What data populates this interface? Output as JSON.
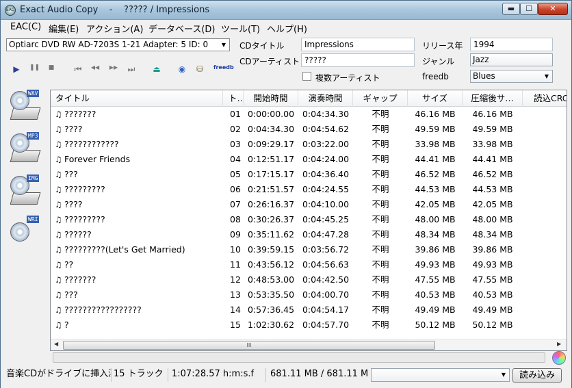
{
  "window": {
    "title": "Exact Audio Copy    -    ????? / Impressions",
    "icon_label": "EAC",
    "min_label": "▬",
    "max_label": "☐",
    "close_label": "✕"
  },
  "menu": [
    "EAC(C)",
    "編集(E)",
    "アクション(A)",
    "データベース(D)",
    "ツール(T)",
    "ヘルプ(H)"
  ],
  "drive": {
    "selected": "Optiarc DVD RW AD-7203S 1-21   Adapter: 5  ID: 0"
  },
  "cd_info": {
    "title_label": "CDタイトル",
    "title_value": "Impressions",
    "artist_label": "CDアーティスト",
    "artist_value": "?????",
    "multi_artist_label": "複数アーティスト",
    "year_label": "リリース年",
    "year_value": "1994",
    "genre_label": "ジャンル",
    "genre_value": "Jazz",
    "freedb_label": "freedb",
    "freedb_value": "Blues"
  },
  "toolbar": {
    "play": "▶",
    "pause": "❚❚",
    "stop": "■",
    "first": "⏮",
    "rewind": "◀◀",
    "forward": "▶▶",
    "last": "⏭",
    "eject": "⏏",
    "freedb_label": "freedb"
  },
  "sidebar": [
    {
      "tag": "WAV",
      "icon": "cd-to-wav-icon"
    },
    {
      "tag": "MP3",
      "icon": "cd-to-mp3-icon"
    },
    {
      "tag": "IMG",
      "icon": "cd-image-icon"
    },
    {
      "tag": "WRI",
      "icon": "write-cd-icon"
    }
  ],
  "columns": [
    "タイトル",
    "ト…",
    "開始時間",
    "演奏時間",
    "ギャップ",
    "サイズ",
    "圧縮後サ…",
    "読込CRC"
  ],
  "tracks": [
    {
      "title": "???????",
      "no": "01",
      "start": "0:00:00.00",
      "length": "0:04:34.30",
      "gap": "不明",
      "size": "46.16 MB",
      "comp": "46.16 MB"
    },
    {
      "title": "????",
      "no": "02",
      "start": "0:04:34.30",
      "length": "0:04:54.62",
      "gap": "不明",
      "size": "49.59 MB",
      "comp": "49.59 MB"
    },
    {
      "title": "????????????",
      "no": "03",
      "start": "0:09:29.17",
      "length": "0:03:22.00",
      "gap": "不明",
      "size": "33.98 MB",
      "comp": "33.98 MB"
    },
    {
      "title": "Forever Friends",
      "no": "04",
      "start": "0:12:51.17",
      "length": "0:04:24.00",
      "gap": "不明",
      "size": "44.41 MB",
      "comp": "44.41 MB"
    },
    {
      "title": "???",
      "no": "05",
      "start": "0:17:15.17",
      "length": "0:04:36.40",
      "gap": "不明",
      "size": "46.52 MB",
      "comp": "46.52 MB"
    },
    {
      "title": "?????????",
      "no": "06",
      "start": "0:21:51.57",
      "length": "0:04:24.55",
      "gap": "不明",
      "size": "44.53 MB",
      "comp": "44.53 MB"
    },
    {
      "title": "????",
      "no": "07",
      "start": "0:26:16.37",
      "length": "0:04:10.00",
      "gap": "不明",
      "size": "42.05 MB",
      "comp": "42.05 MB"
    },
    {
      "title": "?????????",
      "no": "08",
      "start": "0:30:26.37",
      "length": "0:04:45.25",
      "gap": "不明",
      "size": "48.00 MB",
      "comp": "48.00 MB"
    },
    {
      "title": "??????",
      "no": "09",
      "start": "0:35:11.62",
      "length": "0:04:47.28",
      "gap": "不明",
      "size": "48.34 MB",
      "comp": "48.34 MB"
    },
    {
      "title": "?????????(Let's Get Married)",
      "no": "10",
      "start": "0:39:59.15",
      "length": "0:03:56.72",
      "gap": "不明",
      "size": "39.86 MB",
      "comp": "39.86 MB"
    },
    {
      "title": "??",
      "no": "11",
      "start": "0:43:56.12",
      "length": "0:04:56.63",
      "gap": "不明",
      "size": "49.93 MB",
      "comp": "49.93 MB"
    },
    {
      "title": "???????",
      "no": "12",
      "start": "0:48:53.00",
      "length": "0:04:42.50",
      "gap": "不明",
      "size": "47.55 MB",
      "comp": "47.55 MB"
    },
    {
      "title": "???",
      "no": "13",
      "start": "0:53:35.50",
      "length": "0:04:00.70",
      "gap": "不明",
      "size": "40.53 MB",
      "comp": "40.53 MB"
    },
    {
      "title": "?????????????????",
      "no": "14",
      "start": "0:57:36.45",
      "length": "0:04:54.17",
      "gap": "不明",
      "size": "49.49 MB",
      "comp": "49.49 MB"
    },
    {
      "title": "?",
      "no": "15",
      "start": "1:02:30.62",
      "length": "0:04:57.70",
      "gap": "不明",
      "size": "50.12 MB",
      "comp": "50.12 MB"
    }
  ],
  "scrollbar": {
    "left": "◀",
    "right": "▶",
    "grip": "III"
  },
  "status": {
    "disc": "音楽CDがドライブに挿入済み",
    "tracks": "15 トラック",
    "duration": "1:07:28.57 h:m:s.f",
    "size": "681.11 MB / 681.11 M",
    "read_button": "読み込み"
  }
}
